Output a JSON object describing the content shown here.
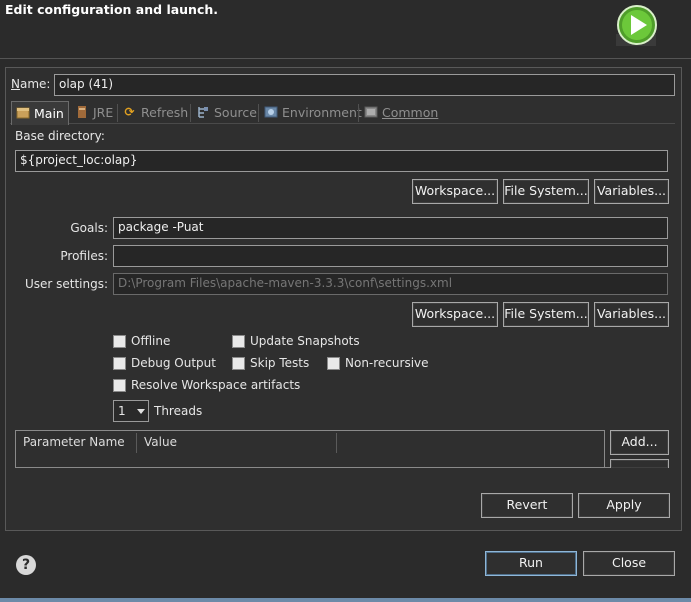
{
  "window": {
    "title": "Edit configuration and launch."
  },
  "name": {
    "label": "Name:",
    "value": "olap (41)"
  },
  "tabs": [
    {
      "label": "Main",
      "icon": "main-tab-icon",
      "active": true
    },
    {
      "label": "JRE",
      "icon": "jre-tab-icon"
    },
    {
      "label": "Refresh",
      "icon": "refresh-tab-icon"
    },
    {
      "label": "Source",
      "icon": "source-tab-icon"
    },
    {
      "label": "Environment",
      "icon": "environment-tab-icon"
    },
    {
      "label": "Common",
      "icon": "common-tab-icon"
    }
  ],
  "base_dir": {
    "label": "Base directory:",
    "value": "${project_loc:olap}",
    "workspace": "Workspace...",
    "filesystem": "File System...",
    "variables": "Variables..."
  },
  "goals": {
    "label": "Goals:",
    "value": "package -Puat"
  },
  "profiles": {
    "label": "Profiles:",
    "value": ""
  },
  "user_settings": {
    "label": "User settings:",
    "value": "D:\\Program Files\\apache-maven-3.3.3\\conf\\settings.xml",
    "workspace": "Workspace...",
    "filesystem": "File System...",
    "variables": "Variables..."
  },
  "options": {
    "offline": "Offline",
    "update_snapshots": "Update Snapshots",
    "debug_output": "Debug Output",
    "skip_tests": "Skip Tests",
    "non_recursive": "Non-recursive",
    "resolve_workspace": "Resolve Workspace artifacts"
  },
  "threads": {
    "value": "1",
    "label": "Threads"
  },
  "params_table": {
    "columns": [
      "Parameter Name",
      "Value"
    ],
    "add": "Add..."
  },
  "actions": {
    "revert": "Revert",
    "apply": "Apply",
    "run": "Run",
    "close": "Close"
  },
  "help": {
    "glyph": "?"
  }
}
